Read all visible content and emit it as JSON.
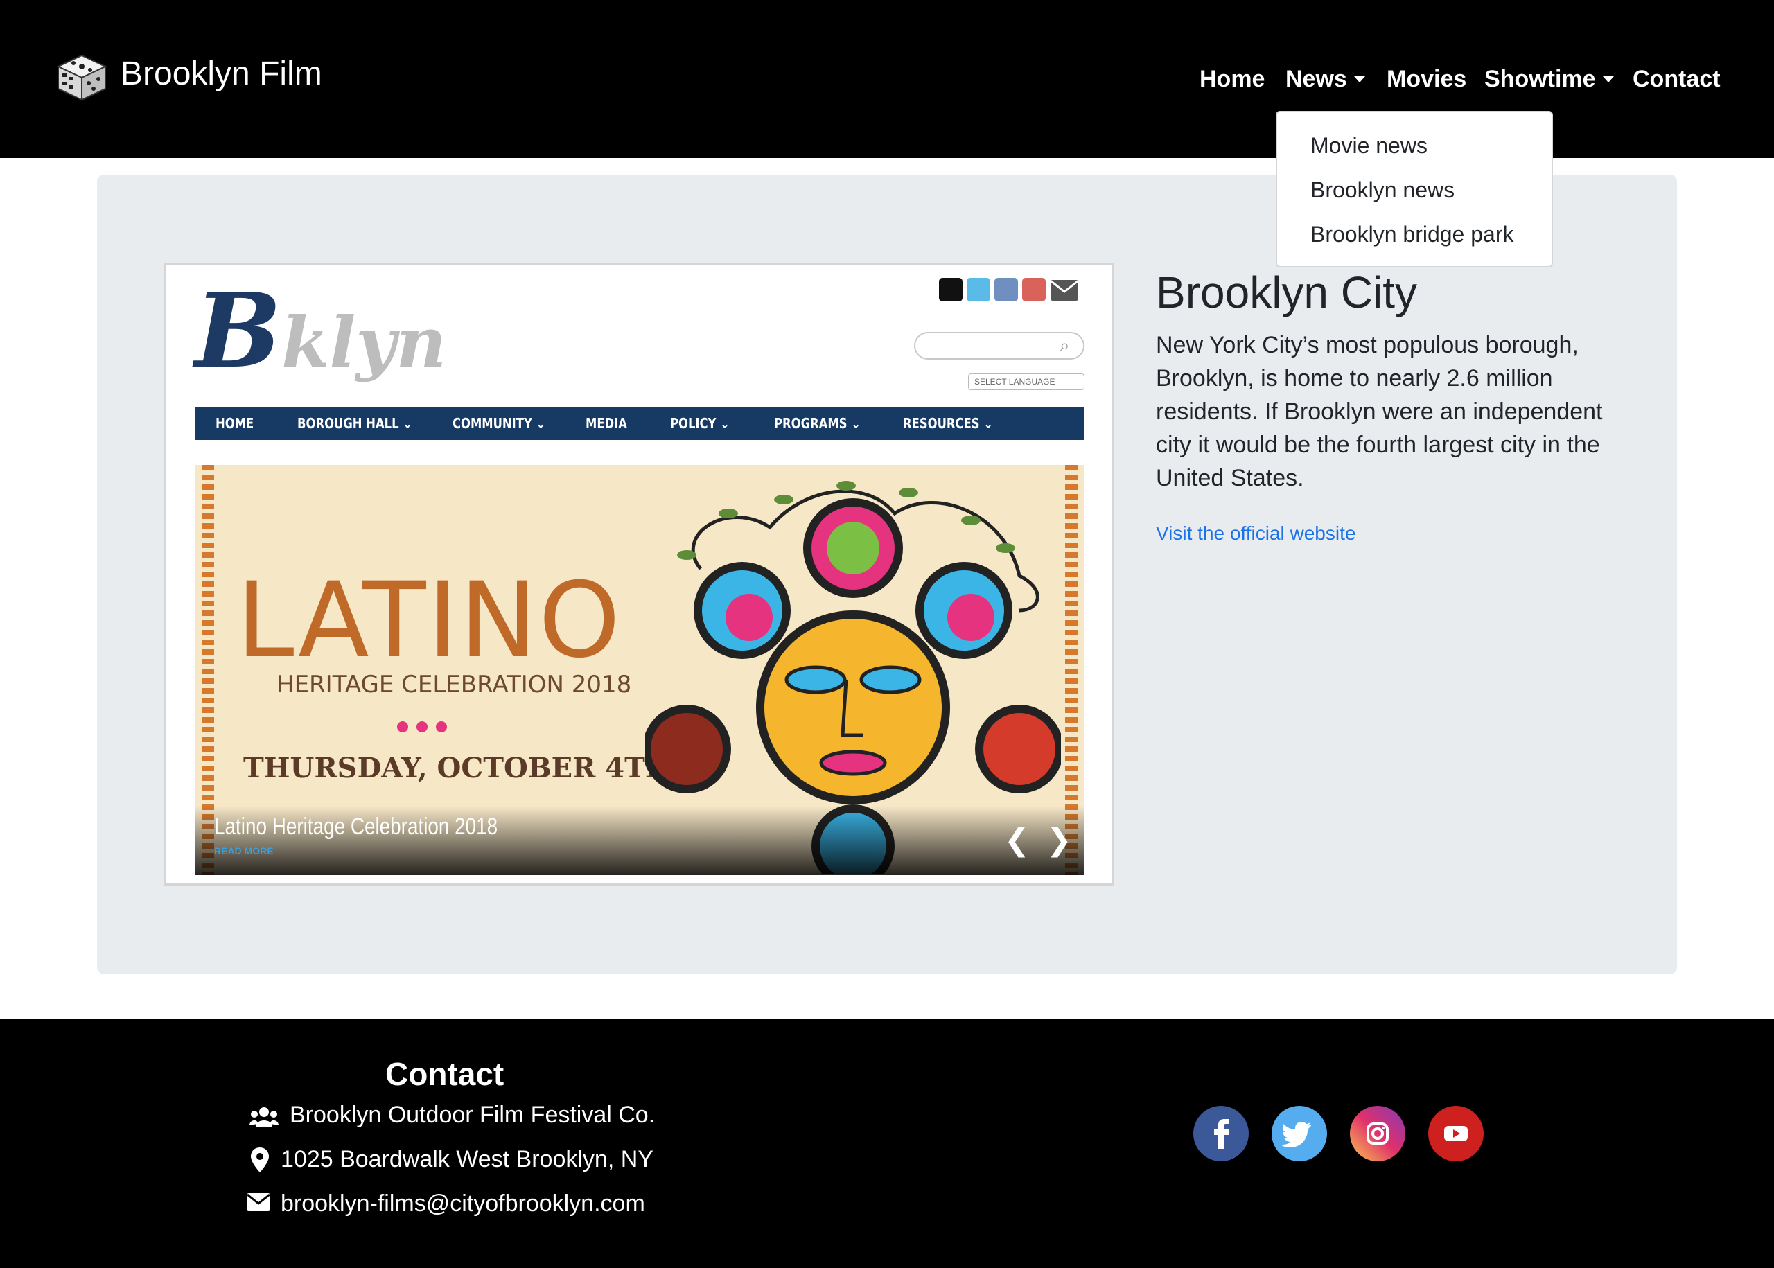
{
  "brand": {
    "name": "Brooklyn Film",
    "logo_icon": "film-dice-icon"
  },
  "nav": {
    "items": [
      {
        "label": "Home",
        "dropdown": false
      },
      {
        "label": "News",
        "dropdown": true
      },
      {
        "label": "Movies",
        "dropdown": false
      },
      {
        "label": "Showtime",
        "dropdown": true
      },
      {
        "label": "Contact",
        "dropdown": false
      }
    ],
    "news_dropdown": {
      "open": true,
      "items": [
        "Movie news",
        "Brooklyn news",
        "Brooklyn bridge park"
      ]
    }
  },
  "feature": {
    "screenshot": {
      "logo_b": "B",
      "logo_rest": "klyn",
      "language_select": "SELECT LANGUAGE",
      "nav": [
        "HOME",
        "BOROUGH HALL ⌄",
        "COMMUNITY ⌄",
        "MEDIA",
        "POLICY ⌄",
        "PROGRAMS ⌄",
        "RESOURCES ⌄"
      ],
      "banner": {
        "headline": "LATINO",
        "subhead": "HERITAGE CELEBRATION 2018",
        "date": "THURSDAY, OCTOBER 4TH",
        "caption": "Latino Heritage Celebration 2018",
        "read_more": "READ MORE"
      }
    },
    "title": "Brooklyn City",
    "description": "New York City’s most populous borough, Brooklyn, is home to nearly 2.6 million residents. If Brooklyn were an independent city it would be the fourth largest city in the United States.",
    "link_label": "Visit the official website"
  },
  "footer": {
    "title": "Contact",
    "company": "Brooklyn Outdoor Film Festival Co.",
    "address": "1025 Boardwalk West Brooklyn, NY",
    "email": "brooklyn-films@cityofbrooklyn.com",
    "social": [
      {
        "name": "facebook",
        "color": "#3b5998"
      },
      {
        "name": "twitter",
        "color": "#55acee"
      },
      {
        "name": "instagram",
        "color": "#c13584"
      },
      {
        "name": "youtube",
        "color": "#cd201f"
      }
    ]
  },
  "colors": {
    "navbar_bg": "#000000",
    "jumbotron_bg": "#e9ecef",
    "link": "#1a73e8",
    "bklyn_nav": "#173a64"
  }
}
